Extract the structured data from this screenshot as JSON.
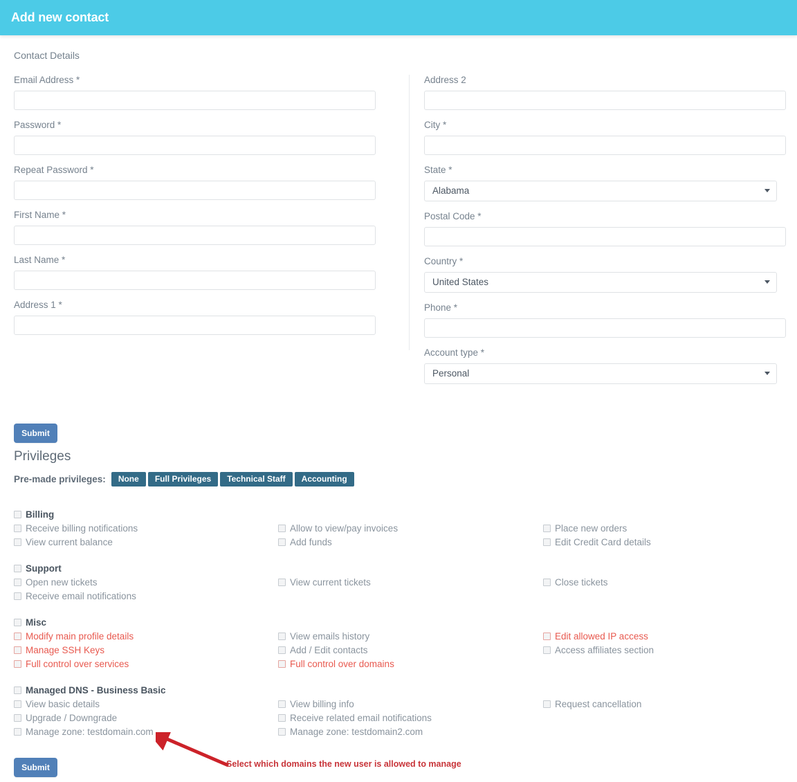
{
  "header": {
    "title": "Add new contact"
  },
  "form": {
    "section_label": "Contact Details",
    "left_fields": [
      {
        "label": "Email Address *",
        "value": "",
        "type": "text",
        "name": "email-field"
      },
      {
        "label": "Password *",
        "value": "",
        "type": "password",
        "name": "password-field"
      },
      {
        "label": "Repeat Password *",
        "value": "",
        "type": "password",
        "name": "repeat-password-field"
      },
      {
        "label": "First Name *",
        "value": "",
        "type": "text",
        "name": "first-name-field"
      },
      {
        "label": "Last Name *",
        "value": "",
        "type": "text",
        "name": "last-name-field"
      },
      {
        "label": "Address 1 *",
        "value": "",
        "type": "text",
        "name": "address1-field"
      }
    ],
    "right_fields": [
      {
        "label": "Address 2",
        "value": "",
        "type": "text",
        "name": "address2-field"
      },
      {
        "label": "City *",
        "value": "",
        "type": "text",
        "name": "city-field"
      },
      {
        "label": "State *",
        "value": "Alabama",
        "type": "select",
        "name": "state-select"
      },
      {
        "label": "Postal Code *",
        "value": "",
        "type": "text",
        "name": "postal-code-field"
      },
      {
        "label": "Country *",
        "value": "United States",
        "type": "select",
        "name": "country-select"
      },
      {
        "label": "Phone *",
        "value": "",
        "type": "text",
        "name": "phone-field"
      },
      {
        "label": "Account type *",
        "value": "Personal",
        "type": "select",
        "name": "account-type-select"
      }
    ],
    "submit_label": "Submit"
  },
  "privileges": {
    "title": "Privileges",
    "premade_label": "Pre-made privileges:",
    "premade_buttons": [
      "None",
      "Full Privileges",
      "Technical Staff",
      "Accounting"
    ],
    "submit_label": "Submit",
    "groups": [
      {
        "name": "billing",
        "head": "Billing",
        "col1": [
          {
            "label": "Receive billing notifications",
            "danger": false
          },
          {
            "label": "View current balance",
            "danger": false
          }
        ],
        "col2": [
          {
            "label": "Allow to view/pay invoices",
            "danger": false
          },
          {
            "label": "Add funds",
            "danger": false
          }
        ],
        "col3": [
          {
            "label": "Place new orders",
            "danger": false
          },
          {
            "label": "Edit Credit Card details",
            "danger": false
          }
        ]
      },
      {
        "name": "support",
        "head": "Support",
        "col1": [
          {
            "label": "Open new tickets",
            "danger": false
          },
          {
            "label": "Receive email notifications",
            "danger": false
          }
        ],
        "col2": [
          {
            "label": "View current tickets",
            "danger": false
          }
        ],
        "col3": [
          {
            "label": "Close tickets",
            "danger": false
          }
        ]
      },
      {
        "name": "misc",
        "head": "Misc",
        "col1": [
          {
            "label": "Modify main profile details",
            "danger": true
          },
          {
            "label": "Manage SSH Keys",
            "danger": true
          },
          {
            "label": "Full control over services",
            "danger": true
          }
        ],
        "col2": [
          {
            "label": "View emails history",
            "danger": false
          },
          {
            "label": "Add / Edit contacts",
            "danger": false
          },
          {
            "label": "Full control over domains",
            "danger": true
          }
        ],
        "col3": [
          {
            "label": "Edit allowed IP access",
            "danger": true
          },
          {
            "label": "Access affiliates section",
            "danger": false
          }
        ]
      },
      {
        "name": "managed-dns",
        "head": "Managed DNS - Business Basic",
        "col1": [
          {
            "label": "View basic details",
            "danger": false
          },
          {
            "label": "Upgrade / Downgrade",
            "danger": false
          },
          {
            "label": "Manage zone: testdomain.com",
            "danger": false
          }
        ],
        "col2": [
          {
            "label": "View billing info",
            "danger": false
          },
          {
            "label": "Receive related email notifications",
            "danger": false
          },
          {
            "label": "Manage zone: testdomain2.com",
            "danger": false
          }
        ],
        "col3": [
          {
            "label": "Request cancellation",
            "danger": false
          }
        ]
      }
    ]
  },
  "annotation": {
    "text": "Select which domains the new user is allowed to manage",
    "color": "#c8353a"
  },
  "colors": {
    "header_bg": "#4ccbe7",
    "submit_btn": "#5180b8",
    "premade_btn": "#336b87",
    "danger_text": "#e8594f"
  }
}
